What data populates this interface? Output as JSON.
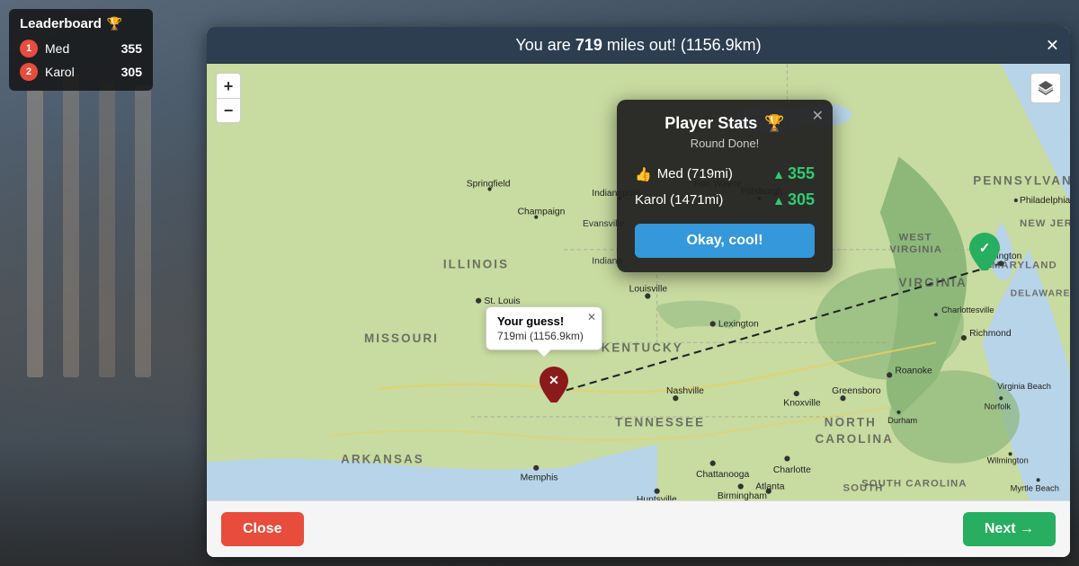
{
  "leaderboard": {
    "title": "Leaderboard",
    "trophy": "🏆",
    "players": [
      {
        "rank": 1,
        "name": "Med",
        "score": 355
      },
      {
        "rank": 2,
        "name": "Karol",
        "score": 305
      }
    ]
  },
  "modal": {
    "header": {
      "text_prefix": "You are ",
      "miles": "719",
      "text_suffix": " miles out!",
      "km": "(1156.9km)"
    },
    "close_x": "✕"
  },
  "map": {
    "zoom_plus": "+",
    "zoom_minus": "−",
    "guess_tooltip": {
      "title": "Your guess!",
      "distance": "719mi (1156.9km)",
      "close": "✕"
    },
    "player_stats": {
      "title": "Player Stats",
      "trophy": "🏆",
      "subtitle": "Round Done!",
      "close": "✕",
      "players": [
        {
          "icon": "👍",
          "name": "Med",
          "dist": "(719mi)",
          "score": 355
        },
        {
          "name": "Karol",
          "dist": "(1471mi)",
          "score": 305
        }
      ],
      "ok_button": "Okay, cool!"
    }
  },
  "footer": {
    "close_label": "Close",
    "next_label": "Next →"
  }
}
